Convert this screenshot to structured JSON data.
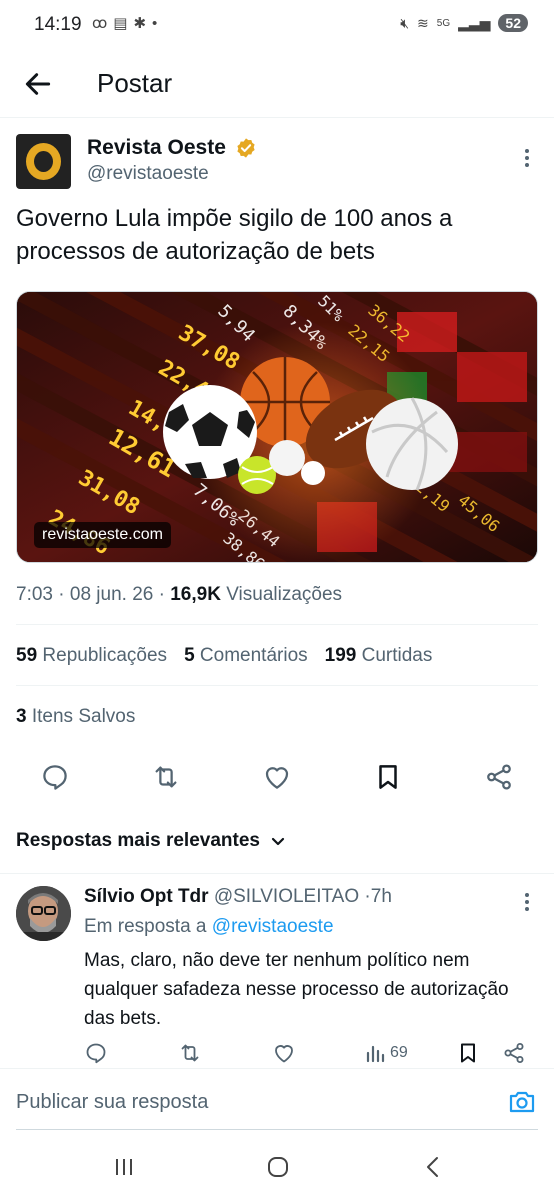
{
  "status_bar": {
    "time": "14:19",
    "battery": "52",
    "network": "5G"
  },
  "header": {
    "title": "Postar"
  },
  "tweet": {
    "author_name": "Revista Oeste",
    "author_handle": "@revistaoeste",
    "text": "Governo Lula impõe sigilo de 100 anos a processos de autorização de bets",
    "media_source": "revistaoeste.com",
    "time": "7:03",
    "date": "08 jun. 26",
    "views_count": "16,9K",
    "views_label": "Visualizações",
    "reposts_count": "59",
    "reposts_label": "Republicações",
    "comments_count": "5",
    "comments_label": "Comentários",
    "likes_count": "199",
    "likes_label": "Curtidas",
    "saved_count": "3",
    "saved_label": "Itens Salvos"
  },
  "replies_section": {
    "sort_label": "Respostas mais relevantes"
  },
  "reply": {
    "author_name": "Sílvio Opt Tdr",
    "author_handle": "@SILVIOLEITAO",
    "age": "7h",
    "in_reply_prefix": "Em resposta a",
    "in_reply_mention": "@revistaoeste",
    "text": "Mas, claro, não deve ter nenhum político nem qualquer safadeza nesse processo de autorização das bets.",
    "views": "69"
  },
  "compose": {
    "placeholder": "Publicar sua resposta"
  },
  "colors": {
    "accent": "#1d9bf0",
    "verified": "#e5a823",
    "secondary_text": "#536471"
  }
}
